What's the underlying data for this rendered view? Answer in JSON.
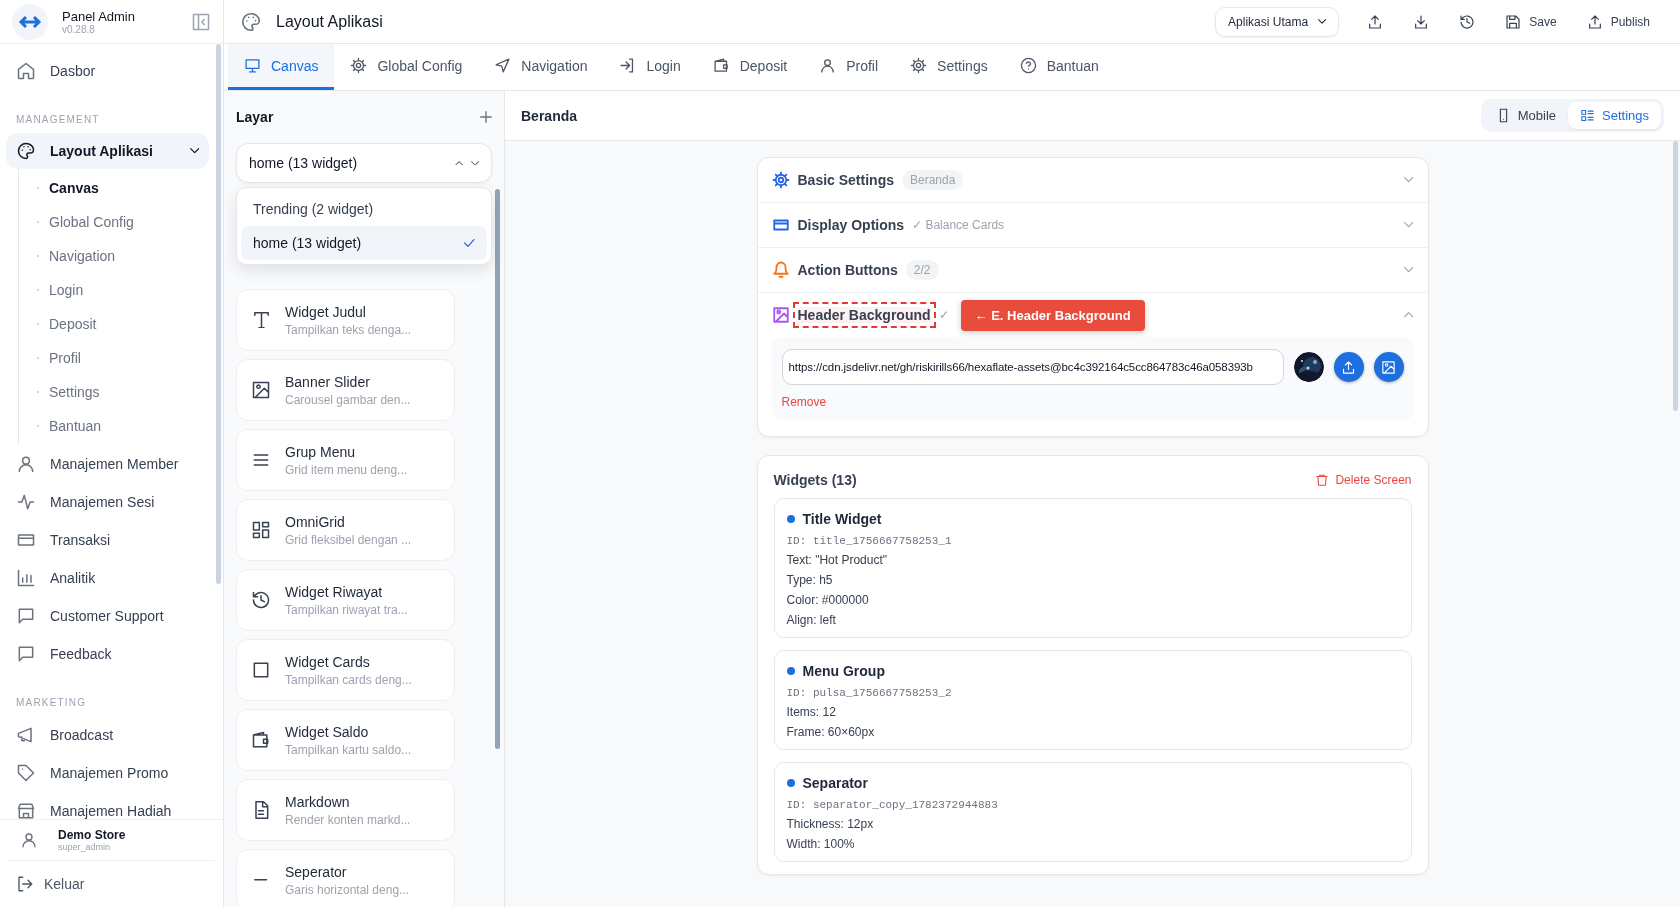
{
  "app": {
    "name": "Panel Admin",
    "version": "v0.28.8"
  },
  "sidebar": {
    "groups": [
      {
        "items": [
          {
            "label": "Dasbor",
            "selected": false
          }
        ]
      },
      {
        "label": "MANAGEMENT",
        "items": [
          {
            "label": "Layout Aplikasi",
            "selected": true,
            "expanded": true,
            "children": [
              {
                "label": "Canvas",
                "selected": true
              },
              {
                "label": "Global Config",
                "selected": false
              },
              {
                "label": "Navigation",
                "selected": false
              },
              {
                "label": "Login",
                "selected": false
              },
              {
                "label": "Deposit",
                "selected": false
              },
              {
                "label": "Profil",
                "selected": false
              },
              {
                "label": "Settings",
                "selected": false
              },
              {
                "label": "Bantuan",
                "selected": false
              }
            ]
          },
          {
            "label": "Manajemen Member",
            "selected": false
          },
          {
            "label": "Manajemen Sesi",
            "selected": false
          },
          {
            "label": "Transaksi",
            "selected": false
          },
          {
            "label": "Analitik",
            "selected": false
          },
          {
            "label": "Customer Support",
            "selected": false
          },
          {
            "label": "Feedback",
            "selected": false
          }
        ]
      },
      {
        "label": "MARKETING",
        "items": [
          {
            "label": "Broadcast",
            "selected": false
          },
          {
            "label": "Manajemen Promo",
            "selected": false
          },
          {
            "label": "Manajemen Hadiah",
            "selected": false
          }
        ]
      }
    ],
    "user": {
      "name": "Demo Store",
      "role": "super_admin"
    },
    "logout": "Keluar"
  },
  "page": {
    "title": "Layout Aplikasi",
    "app_select": "Aplikasi Utama",
    "actions": [
      {
        "label": "Save"
      },
      {
        "label": "Publish"
      }
    ]
  },
  "tabs": [
    {
      "label": "Canvas",
      "selected": true
    },
    {
      "label": "Global Config",
      "selected": false
    },
    {
      "label": "Navigation",
      "selected": false
    },
    {
      "label": "Login",
      "selected": false
    },
    {
      "label": "Deposit",
      "selected": false
    },
    {
      "label": "Profil",
      "selected": false
    },
    {
      "label": "Settings",
      "selected": false
    },
    {
      "label": "Bantuan",
      "selected": false
    }
  ],
  "screens": {
    "title": "Layar",
    "select": {
      "value": "home (13 widget)",
      "expanded": true
    },
    "options": [
      {
        "label": "Trending (2 widget)",
        "selected": false
      },
      {
        "label": "home (13 widget)",
        "selected": true
      }
    ],
    "widget_types": [
      {
        "name": "Widget Judul",
        "description": "Tampilkan teks denga..."
      },
      {
        "name": "Banner Slider",
        "description": "Carousel gambar den..."
      },
      {
        "name": "Grup Menu",
        "description": "Grid item menu deng..."
      },
      {
        "name": "OmniGrid",
        "description": "Grid fleksibel dengan ..."
      },
      {
        "name": "Widget Riwayat",
        "description": "Tampilkan riwayat tra..."
      },
      {
        "name": "Widget Cards",
        "description": "Tampilkan cards deng..."
      },
      {
        "name": "Widget Saldo",
        "description": "Tampilkan kartu saldo..."
      },
      {
        "name": "Markdown",
        "description": "Render konten markd..."
      },
      {
        "name": "Seperator",
        "description": "Garis horizontal deng..."
      }
    ]
  },
  "editor": {
    "screen": "Beranda",
    "view_toggle": [
      {
        "label": "Mobile",
        "selected": false
      },
      {
        "label": "Settings",
        "selected": true
      }
    ],
    "sections": [
      {
        "title": "Basic Settings",
        "color": "#2563eb",
        "badge": "Beranda",
        "expanded": false
      },
      {
        "title": "Display Options",
        "color": "#2563eb",
        "note": "✓ Balance Cards",
        "expanded": false
      },
      {
        "title": "Action Buttons",
        "color": "#f97316",
        "badge": "2/2",
        "expanded": false
      },
      {
        "title": "Header Background",
        "color": "#a855f7",
        "note": "✓",
        "expanded": true,
        "highlighted": true,
        "annotation": "← E. Header Background",
        "url": "https://cdn.jsdelivr.net/gh/riskirills66/hexaflate-assets@bc4c392164c5cc864783c46a058393b",
        "remove": "Remove"
      }
    ],
    "widgets": {
      "title": "Widgets (13)",
      "delete": "Delete Screen",
      "items": [
        {
          "title": "Title Widget",
          "id": "ID: title_1756667758253_1",
          "lines": [
            "Text: \"Hot Product\"",
            "Type: h5",
            "Color: #000000",
            "Align: left"
          ]
        },
        {
          "title": "Menu Group",
          "id": "ID: pulsa_1756667758253_2",
          "lines": [
            "Items: 12",
            "Frame: 60×60px"
          ]
        },
        {
          "title": "Separator",
          "id": "ID: separator_copy_1782372944883",
          "lines": [
            "Thickness: 12px",
            "Width: 100%"
          ]
        }
      ]
    }
  }
}
